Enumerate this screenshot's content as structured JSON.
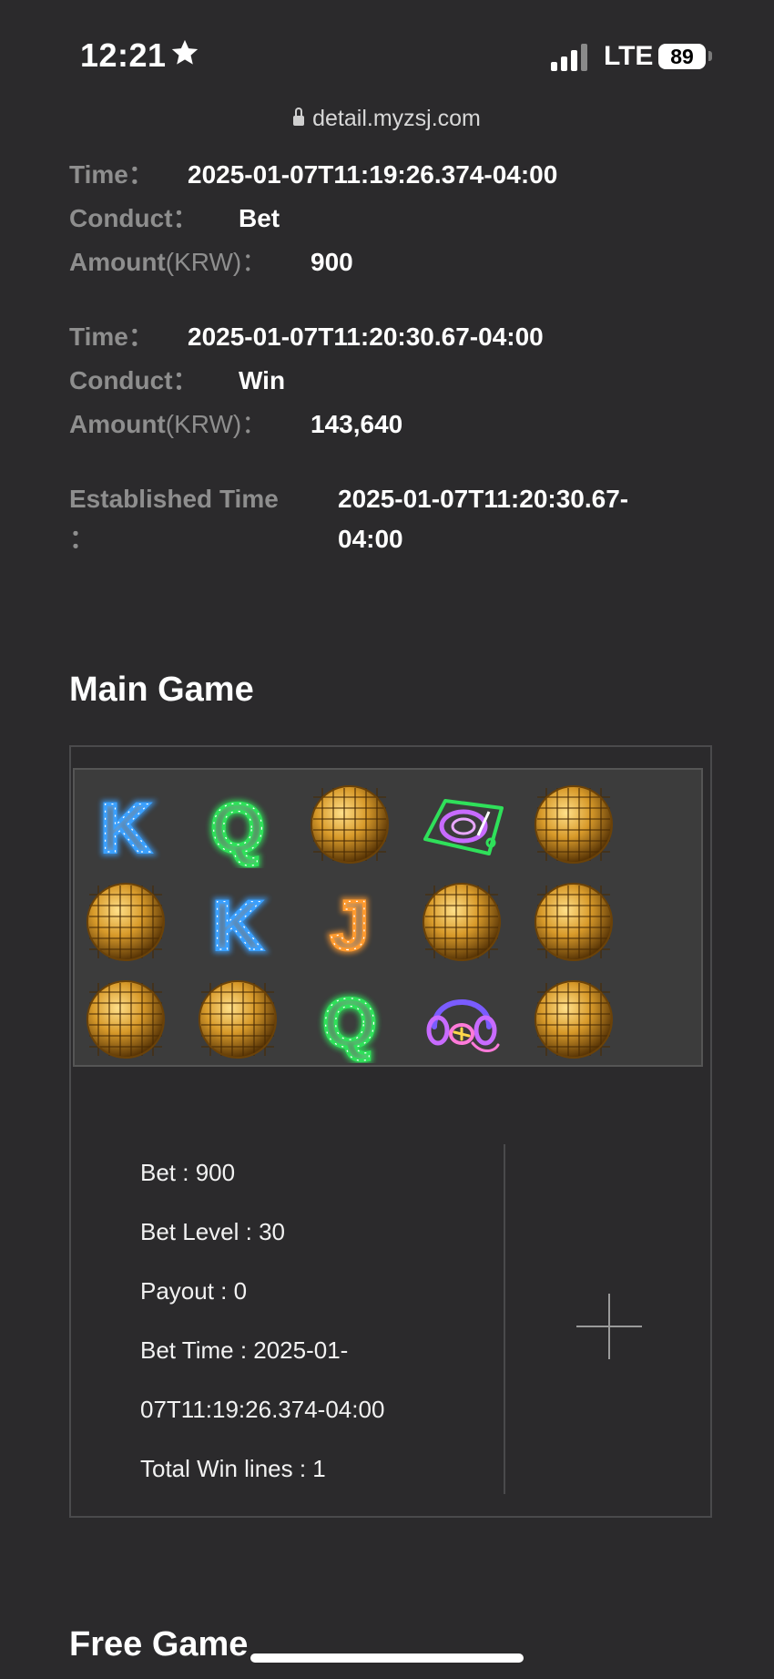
{
  "status_bar": {
    "time": "12:21",
    "network": "LTE",
    "battery": "89"
  },
  "url_bar": {
    "domain": "detail.myzsj.com"
  },
  "records": [
    {
      "time_label": "Time：",
      "time": "2025-01-07T11:19:26.374-04:00",
      "conduct_label": "Conduct：",
      "conduct": "Bet",
      "amount_label": "Amount",
      "amount_unit": "(KRW)：",
      "amount": "900"
    },
    {
      "time_label": "Time：",
      "time": "2025-01-07T11:20:30.67-04:00",
      "conduct_label": "Conduct：",
      "conduct": "Win",
      "amount_label": "Amount",
      "amount_unit": "(KRW)：",
      "amount": "143,640"
    }
  ],
  "established": {
    "label": "Established Time",
    "colon": "：",
    "value_line1": "2025-01-07T11:20:30.67-",
    "value_line2": "04:00"
  },
  "main_game": {
    "title": "Main Game",
    "reels": [
      [
        "k-symbol",
        "q-symbol",
        "disco-ball-symbol",
        "turntable-symbol",
        "disco-ball-symbol"
      ],
      [
        "disco-ball-symbol",
        "k-symbol",
        "j-symbol",
        "disco-ball-symbol",
        "disco-ball-symbol"
      ],
      [
        "disco-ball-symbol",
        "disco-ball-symbol",
        "q-symbol",
        "headphones-symbol",
        "disco-ball-symbol"
      ]
    ],
    "info": {
      "bet": "Bet : 900",
      "bet_level": "Bet Level : 30",
      "payout": "Payout : 0",
      "bet_time_line1": "Bet Time : 2025-01-",
      "bet_time_line2": "07T11:19:26.374-04:00",
      "total_win_lines": "Total Win lines : 1"
    },
    "expand_icon": "plus-icon"
  },
  "free_game": {
    "title": "Free Game"
  },
  "colors": {
    "background": "#2b2a2c",
    "label": "#8e8e8e",
    "value": "#ffffff",
    "k": "#3aa0ff",
    "q": "#2fe05a",
    "j": "#ff9a2e",
    "gold": "#d89a2a"
  }
}
